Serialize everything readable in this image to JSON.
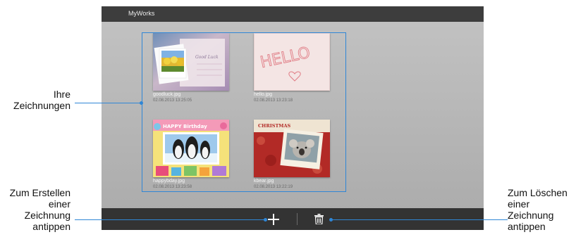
{
  "app": {
    "title": "MyWorks"
  },
  "gallery": {
    "items": [
      {
        "filename": "goodluck.jpg",
        "date": "02.08.2013 13:25:05",
        "card_text": "Good Luck"
      },
      {
        "filename": "hello.jpg",
        "date": "02.08.2013 13:23:18",
        "card_text": "HELLO"
      },
      {
        "filename": "happybday.jpg",
        "date": "02.08.2013 13:23:58",
        "card_text": "HAPPY Birthday"
      },
      {
        "filename": "kbear.jpg",
        "date": "02.08.2013 13:22:19",
        "card_text": "CHRISTMAS"
      }
    ]
  },
  "toolbar": {
    "add_icon": "plus-icon",
    "delete_icon": "trash-icon"
  },
  "annotations": {
    "drawings_label": "Ihre\nZeichnungen",
    "create_label": "Zum Erstellen\neiner\nZeichnung\nantippen",
    "delete_label": "Zum Löschen\neiner\nZeichnung\nantippen"
  },
  "colors": {
    "callout_blue": "#2f86d6",
    "titlebar": "#3d3d3d",
    "bottombar": "#333333"
  }
}
